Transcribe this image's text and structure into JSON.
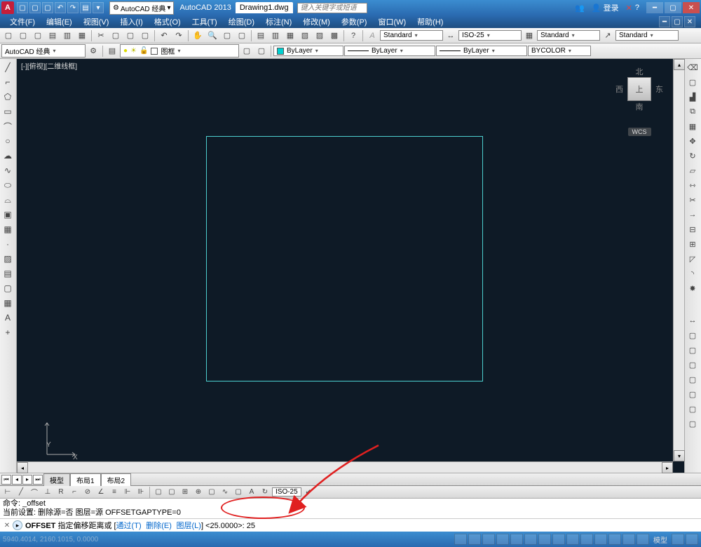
{
  "title_bar": {
    "workspace_label": "AutoCAD 经典",
    "app_name": "AutoCAD 2013",
    "doc_name": "Drawing1.dwg",
    "search_placeholder": "键入关键字或短语",
    "login_label": "登录"
  },
  "menu": {
    "items": [
      "文件(F)",
      "编辑(E)",
      "视图(V)",
      "插入(I)",
      "格式(O)",
      "工具(T)",
      "绘图(D)",
      "标注(N)",
      "修改(M)",
      "参数(P)",
      "窗口(W)",
      "帮助(H)"
    ]
  },
  "toolbars": {
    "workspace_dd": "AutoCAD 经典",
    "layer_name": "图框",
    "style_standard": "Standard",
    "dim_style": "ISO-25",
    "text_style": "Standard",
    "table_style": "Standard",
    "bylayer": "ByLayer",
    "bycolor": "BYCOLOR",
    "bylayer_color": "#00d0d0"
  },
  "canvas": {
    "view_label": "[-][俯视][二维线框]",
    "ucs_x": "X",
    "ucs_y": "Y",
    "viewcube": {
      "n": "北",
      "s": "南",
      "e": "东",
      "w": "西",
      "face": "上",
      "wcs": "WCS"
    }
  },
  "layout_tabs": {
    "model": "模型",
    "layout1": "布局1",
    "layout2": "布局2"
  },
  "command": {
    "iso_dd": "ISO-25",
    "hist1": "命令: _offset",
    "hist2": "当前设置: 删除源=否  图层=源  OFFSETGAPTYPE=0",
    "prompt_cmd": "OFFSET",
    "prompt_text": " 指定偏移距离或 [",
    "opt1": "通过(T)",
    "opt2": "删除(E)",
    "opt3": "图层(L)",
    "prompt_default": "] <25.0000>:  ",
    "input_value": "25"
  },
  "status": {
    "coords": "5940.4014, 2160.1015, 0.0000",
    "model_btn": "模型"
  }
}
